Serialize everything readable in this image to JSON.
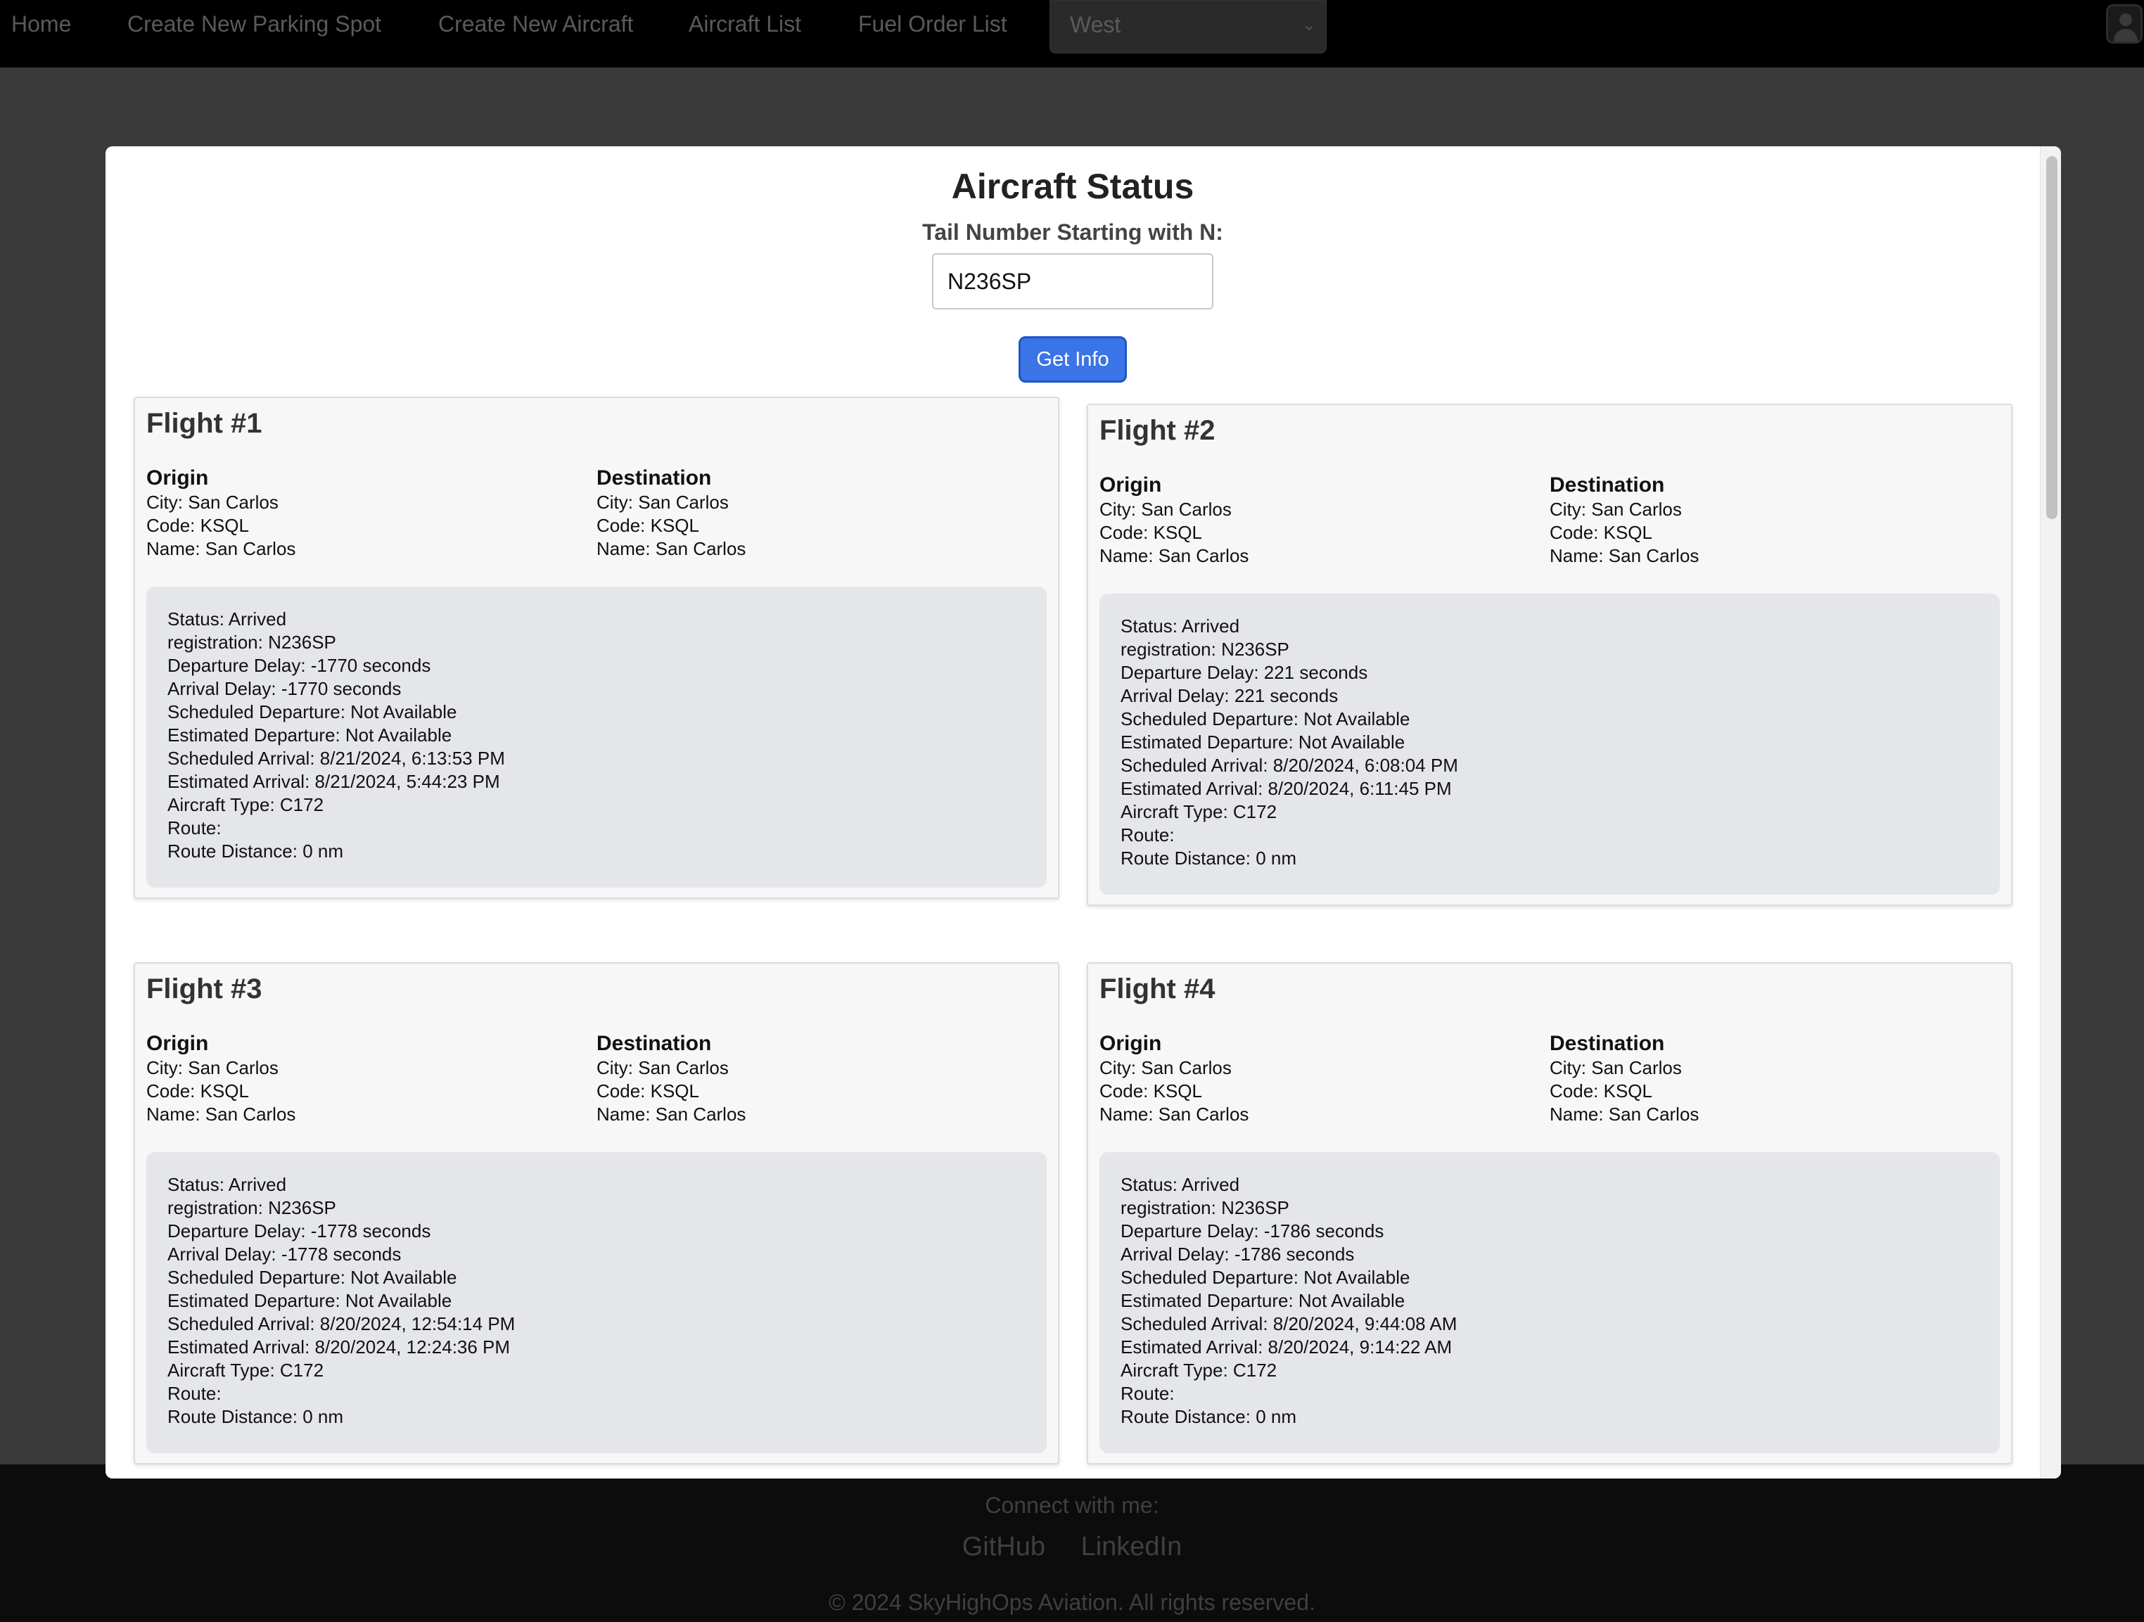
{
  "nav": {
    "items": [
      "Home",
      "Create New Parking Spot",
      "Create New Aircraft",
      "Aircraft List",
      "Fuel Order List"
    ],
    "region_select": "West"
  },
  "modal": {
    "title": "Aircraft Status",
    "tail_label": "Tail Number Starting with N:",
    "tail_value": "N236SP",
    "button_label": "Get Info",
    "labels": {
      "origin": "Origin",
      "destination": "Destination"
    },
    "flights": [
      {
        "title": "Flight #1",
        "origin": [
          "City: San Carlos",
          "Code: KSQL",
          "Name: San Carlos"
        ],
        "destination": [
          "City: San Carlos",
          "Code: KSQL",
          "Name: San Carlos"
        ],
        "details": [
          "Status: Arrived",
          "registration: N236SP",
          "Departure Delay: -1770 seconds",
          "Arrival Delay: -1770 seconds",
          "Scheduled Departure: Not Available",
          "Estimated Departure: Not Available",
          "Scheduled Arrival: 8/21/2024, 6:13:53 PM",
          "Estimated Arrival: 8/21/2024, 5:44:23 PM",
          "Aircraft Type: C172",
          "Route:",
          "Route Distance: 0 nm"
        ]
      },
      {
        "title": "Flight #2",
        "origin": [
          "City: San Carlos",
          "Code: KSQL",
          "Name: San Carlos"
        ],
        "destination": [
          "City: San Carlos",
          "Code: KSQL",
          "Name: San Carlos"
        ],
        "details": [
          "Status: Arrived",
          "registration: N236SP",
          "Departure Delay: 221 seconds",
          "Arrival Delay: 221 seconds",
          "Scheduled Departure: Not Available",
          "Estimated Departure: Not Available",
          "Scheduled Arrival: 8/20/2024, 6:08:04 PM",
          "Estimated Arrival: 8/20/2024, 6:11:45 PM",
          "Aircraft Type: C172",
          "Route:",
          "Route Distance: 0 nm"
        ]
      },
      {
        "title": "Flight #3",
        "origin": [
          "City: San Carlos",
          "Code: KSQL",
          "Name: San Carlos"
        ],
        "destination": [
          "City: San Carlos",
          "Code: KSQL",
          "Name: San Carlos"
        ],
        "details": [
          "Status: Arrived",
          "registration: N236SP",
          "Departure Delay: -1778 seconds",
          "Arrival Delay: -1778 seconds",
          "Scheduled Departure: Not Available",
          "Estimated Departure: Not Available",
          "Scheduled Arrival: 8/20/2024, 12:54:14 PM",
          "Estimated Arrival: 8/20/2024, 12:24:36 PM",
          "Aircraft Type: C172",
          "Route:",
          "Route Distance: 0 nm"
        ]
      },
      {
        "title": "Flight #4",
        "origin": [
          "City: San Carlos",
          "Code: KSQL",
          "Name: San Carlos"
        ],
        "destination": [
          "City: San Carlos",
          "Code: KSQL",
          "Name: San Carlos"
        ],
        "details": [
          "Status: Arrived",
          "registration: N236SP",
          "Departure Delay: -1786 seconds",
          "Arrival Delay: -1786 seconds",
          "Scheduled Departure: Not Available",
          "Estimated Departure: Not Available",
          "Scheduled Arrival: 8/20/2024, 9:44:08 AM",
          "Estimated Arrival: 8/20/2024, 9:14:22 AM",
          "Aircraft Type: C172",
          "Route:",
          "Route Distance: 0 nm"
        ]
      }
    ]
  },
  "footer": {
    "connect": "Connect with me:",
    "links": [
      "GitHub",
      "LinkedIn"
    ],
    "copyright": "© 2024 SkyHighOps Aviation. All rights reserved."
  },
  "colors": {
    "button_bg": "#3a74e6",
    "card_bg": "#f7f7f7",
    "details_bg": "#e5e6ea",
    "navbar_bg": "#000000"
  }
}
